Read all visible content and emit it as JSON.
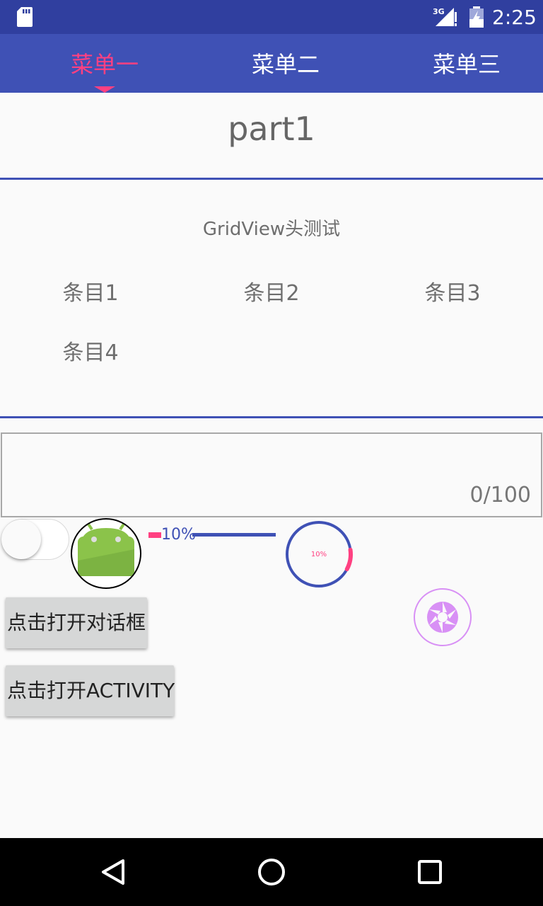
{
  "status_bar": {
    "time": "2:25",
    "network": "3G",
    "sd_card_icon": "sd-card-icon",
    "signal_icon": "signal-icon",
    "battery_icon": "battery-charging-icon"
  },
  "tabs": [
    {
      "label": "菜单一",
      "active": true
    },
    {
      "label": "菜单二",
      "active": false
    },
    {
      "label": "菜单三",
      "active": false
    }
  ],
  "part_title": "part1",
  "grid": {
    "header": "GridView头测试",
    "items": [
      "条目1",
      "条目2",
      "条目3",
      "条目4"
    ]
  },
  "edit_text": {
    "value": "",
    "counter": "0/100"
  },
  "switch": {
    "checked": false
  },
  "horizontal_progress": {
    "label": "10%",
    "progress": 0.1
  },
  "circular_progress": {
    "label": "10%",
    "progress": 0.1
  },
  "buttons": {
    "open_dialog": "点击打开对话框",
    "open_activity": "点击打开ACTIVITY"
  },
  "fab_icon": "camera-shutter-icon",
  "nav_bar": {
    "back_icon": "back-icon",
    "home_icon": "home-icon",
    "recents_icon": "recents-icon"
  },
  "colors": {
    "primary": "#3f51b5",
    "primary_dark": "#303f9f",
    "accent": "#ff4081",
    "fab": "#e040fb"
  }
}
